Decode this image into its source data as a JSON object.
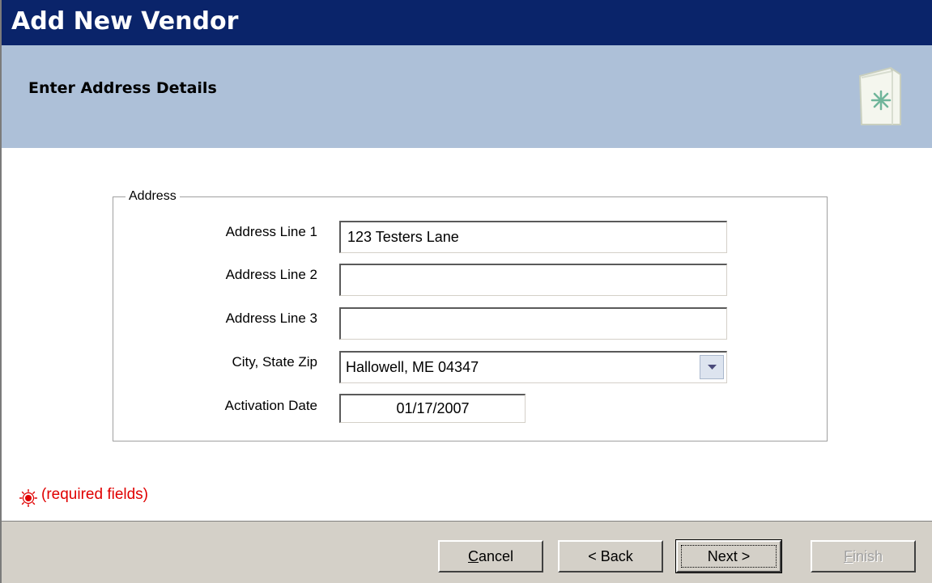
{
  "window": {
    "title": "Add New Vendor"
  },
  "header": {
    "title": "Enter Address Details",
    "icon": "wizard-page-icon"
  },
  "address_group": {
    "legend": "Address",
    "fields": {
      "line1": {
        "label": "Address Line 1",
        "value": "123 Testers Lane"
      },
      "line2": {
        "label": "Address Line 2",
        "value": ""
      },
      "line3": {
        "label": "Address Line 3",
        "value": ""
      },
      "city_state_zip": {
        "label": "City, State  Zip",
        "value": "Hallowell, ME  04347"
      },
      "activation_date": {
        "label": "Activation Date",
        "value": "01/17/2007"
      }
    }
  },
  "required_note": {
    "text": "(required fields)",
    "icon": "required-marker-icon",
    "color": "#e00000"
  },
  "buttons": {
    "cancel_pre": "",
    "cancel_ul": "C",
    "cancel_post": "ancel",
    "back": "< Back",
    "next": "Next >",
    "finish_ul": "F",
    "finish_post": "inish"
  },
  "colors": {
    "title_bar": "#0a246a",
    "header_band": "#adc0d8",
    "button_face": "#d4d0c8"
  }
}
